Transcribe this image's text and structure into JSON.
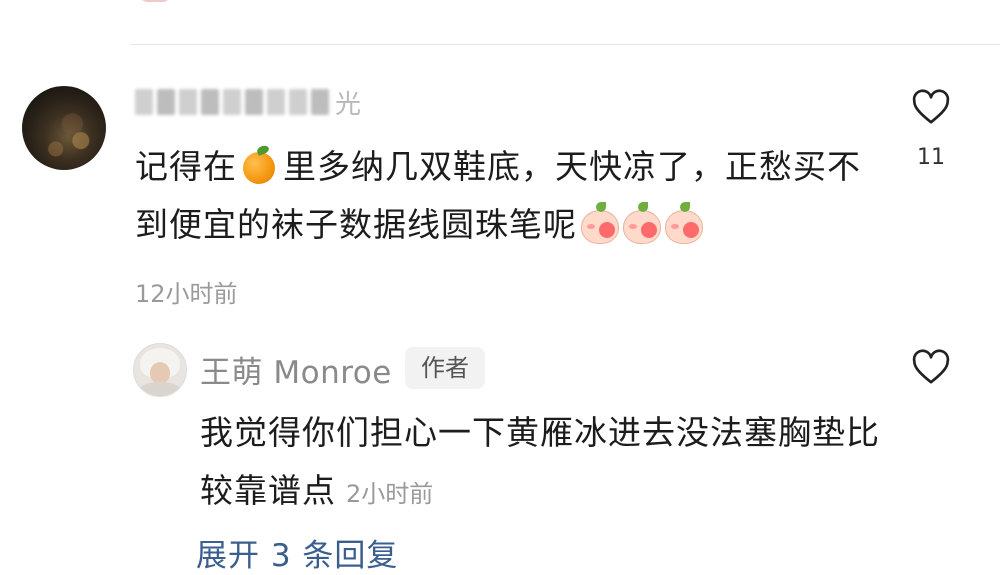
{
  "comment": {
    "username_visible_tail": "光",
    "text_part1": "记得在",
    "text_part2": "里多纳几双鞋底，天快凉了，正愁买不到便宜的袜子数据线圆珠笔呢",
    "time": "12小时前",
    "like_count": "11",
    "icons": [
      "orange-emoji",
      "peach-emoji",
      "peach-emoji",
      "peach-emoji",
      "heart-outline-icon"
    ]
  },
  "reply": {
    "author_name": "王萌 Monroe",
    "author_badge": "作者",
    "text": "我觉得你们担心一下黄雁冰进去没法塞胸垫比较靠谱点",
    "time": "2小时前"
  },
  "expand": {
    "label": "展开 3 条回复"
  },
  "colors": {
    "text_primary": "#1c1c1c",
    "text_secondary": "#9a9a9a",
    "link": "#3a5f8f",
    "badge_bg": "#f2f2f2"
  }
}
